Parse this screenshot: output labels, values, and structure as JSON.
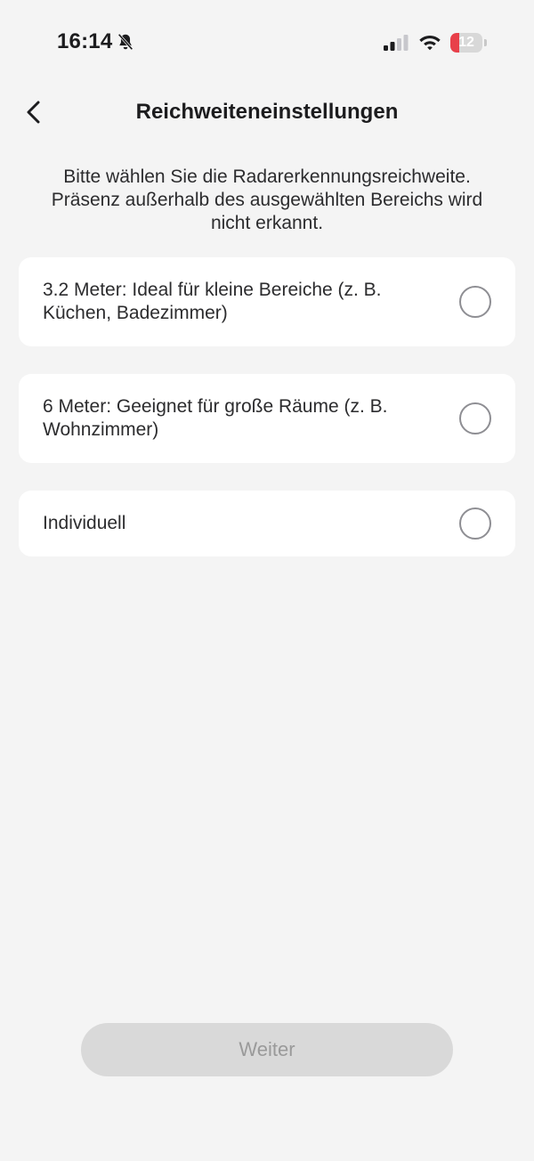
{
  "status_bar": {
    "time": "16:14",
    "battery_level": "12",
    "battery_fraction": 0.12,
    "icons": [
      "bell-slash-icon",
      "cellular-signal-icon",
      "wifi-icon",
      "battery-icon"
    ]
  },
  "header": {
    "back_icon": "chevron-left-icon",
    "title": "Reichweiteneinstellungen"
  },
  "description": "Bitte wählen Sie die Radarerkennungsreichweite. Präsenz außerhalb des ausgewählten Bereichs wird nicht erkannt.",
  "options": [
    {
      "label": "3.2 Meter: Ideal für kleine Bereiche (z. B. Küchen, Badezimmer)",
      "selected": false
    },
    {
      "label": "6 Meter: Geeignet für große Räume (z. B. Wohnzimmer)",
      "selected": false
    },
    {
      "label": "Individuell",
      "selected": false
    }
  ],
  "footer": {
    "continue_label": "Weiter",
    "continue_enabled": false
  },
  "colors": {
    "background": "#f4f4f4",
    "card": "#ffffff",
    "battery_low": "#e8404a",
    "button_disabled": "#d9d9d9",
    "button_text_disabled": "#9a9a9a"
  }
}
